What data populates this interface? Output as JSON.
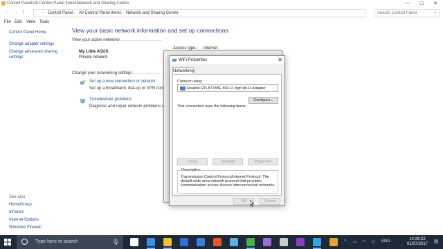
{
  "window": {
    "title": "Control Panel\\All Control Panel Items\\Network and Sharing Centre",
    "minimize": "—",
    "maximize": "☐",
    "close": "✕"
  },
  "address": {
    "back": "←",
    "forward": "→",
    "up": "↑",
    "crumbs": [
      "Control Panel",
      "All Control Panel Items",
      "Network and Sharing Centre"
    ],
    "separator": "›",
    "search_placeholder": "Search Control Panel"
  },
  "menu": [
    "File",
    "Edit",
    "View",
    "Tools"
  ],
  "sidebar": {
    "items": [
      "Control Panel Home",
      "Change adapter settings",
      "Change advanced sharing settings"
    ],
    "see_also_label": "See also",
    "see_also": [
      "HomeGroup",
      "Infrared",
      "Internet Options",
      "Windows Firewall"
    ]
  },
  "main": {
    "heading": "View your basic network information and set up connections",
    "active_networks": "View your active networks",
    "network_name": "My Little ASUS",
    "network_type": "Private network",
    "access_type_label": "Access type:",
    "access_type_value": "Internet",
    "change_settings": "Change your networking settings",
    "tasks": [
      {
        "link": "Set up a new connection or network",
        "desc": "Set up a broadband, dial-up or VPN conne"
      },
      {
        "link": "Troubleshoot problems",
        "desc": "Diagnose and repair network problems or ge"
      }
    ]
  },
  "dialog": {
    "title": "WiFi Properties",
    "tab": "Networking",
    "connect_using_label": "Connect using:",
    "adapter": "Realtek RTL8723BE 802.11 bgn Wi-Fi Adapter",
    "configure": "Configure...",
    "items_label": "This connection uses the following items:",
    "install": "Install",
    "uninstall": "Uninstall",
    "properties": "Properties",
    "description_label": "Description",
    "description": "Transmission Control Protocol/Internet Protocol. The default wide area network protocol that provides communication across diverse interconnected networks.",
    "ok": "OK",
    "cancel": "Cancel",
    "close": "✕"
  },
  "taskbar": {
    "search_text": "Type here to search",
    "tray_lang": "ENG",
    "time": "14:39:22",
    "date": "01/07/2017",
    "icons": [
      {
        "name": "task-view-icon",
        "color": "#ffffff"
      },
      {
        "name": "edge-icon",
        "color": "#3a8ee6"
      },
      {
        "name": "file-explorer-icon",
        "color": "#f0c040"
      },
      {
        "name": "store-icon",
        "color": "#2f6fd6"
      },
      {
        "name": "mail-icon",
        "color": "#3b7fd9"
      },
      {
        "name": "media-icon",
        "color": "#e25a2a"
      },
      {
        "name": "control-panel-icon",
        "color": "#5ab1e8"
      },
      {
        "name": "chrome-icon",
        "color": "#4caf50"
      },
      {
        "name": "app-icon",
        "color": "#9c6bd4"
      },
      {
        "name": "settings-icon",
        "color": "#cccccc"
      },
      {
        "name": "onenote-icon",
        "color": "#8a3fbf"
      },
      {
        "name": "skype-icon",
        "color": "#31a8e0"
      },
      {
        "name": "paint-icon",
        "color": "#e8a03a"
      }
    ]
  }
}
